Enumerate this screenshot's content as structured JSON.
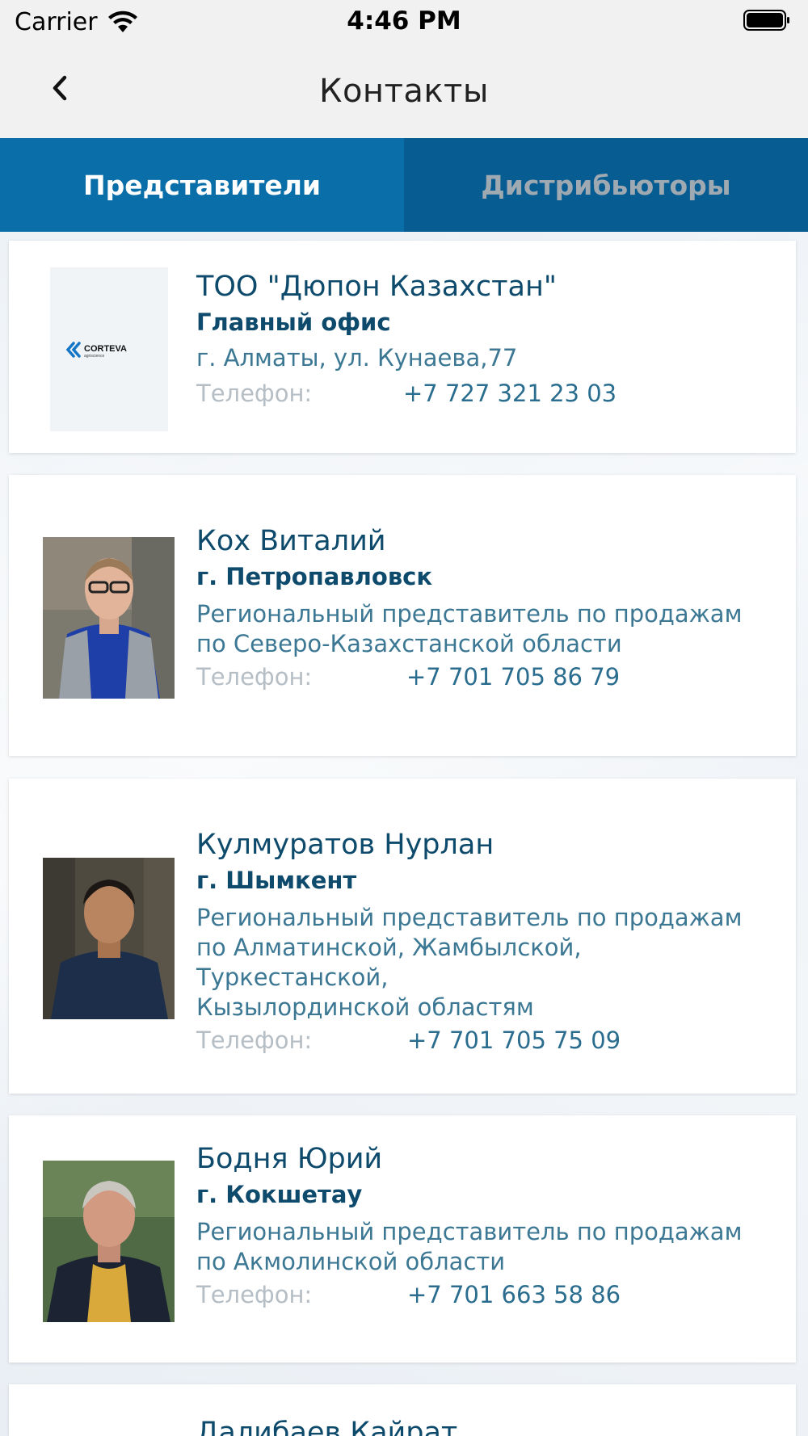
{
  "status_bar": {
    "carrier": "Carrier",
    "time": "4:46 PM"
  },
  "nav": {
    "title": "Контакты"
  },
  "tabs": [
    {
      "label": "Представители",
      "active": true
    },
    {
      "label": "Дистрибьюторы",
      "active": false
    }
  ],
  "contacts": [
    {
      "name": "ТОО \"Дюпон Казахстан\"",
      "subtitle": "Главный офис",
      "desc": "г. Алматы, ул. Кунаева,77",
      "phone_label": "Телефон:",
      "phone": "+7 727 321 23 03",
      "logo_text": "CORTEVA",
      "logo_sub": "agriscience"
    },
    {
      "name": "Кох Виталий",
      "subtitle": "г. Петропавловск",
      "desc_lines": [
        "Региональный представитель по продажам",
        "по Северо-Казахстанской области"
      ],
      "phone_label": "Телефон:",
      "phone": "+7 701 705 86 79"
    },
    {
      "name": "Кулмуратов Нурлан",
      "subtitle": "г. Шымкент",
      "desc_lines": [
        "Региональный представитель по продажам",
        "по Алматинской, Жамбылской, Туркестанской,",
        "Кызылординской областям"
      ],
      "phone_label": "Телефон:",
      "phone": "+7 701 705 75 09"
    },
    {
      "name": "Бодня Юрий",
      "subtitle": "г. Кокшетау",
      "desc_lines": [
        "Региональный представитель по продажам",
        "по Акмолинской области"
      ],
      "phone_label": "Телефон:",
      "phone": "+7 701 663 58 86"
    },
    {
      "name": "Далибаев Кайрат"
    }
  ],
  "colors": {
    "tab_active": "#0a6ea9",
    "tab_inactive": "#075c92",
    "name_text": "#0d4a6b",
    "phone_label": "#b5bec5"
  }
}
